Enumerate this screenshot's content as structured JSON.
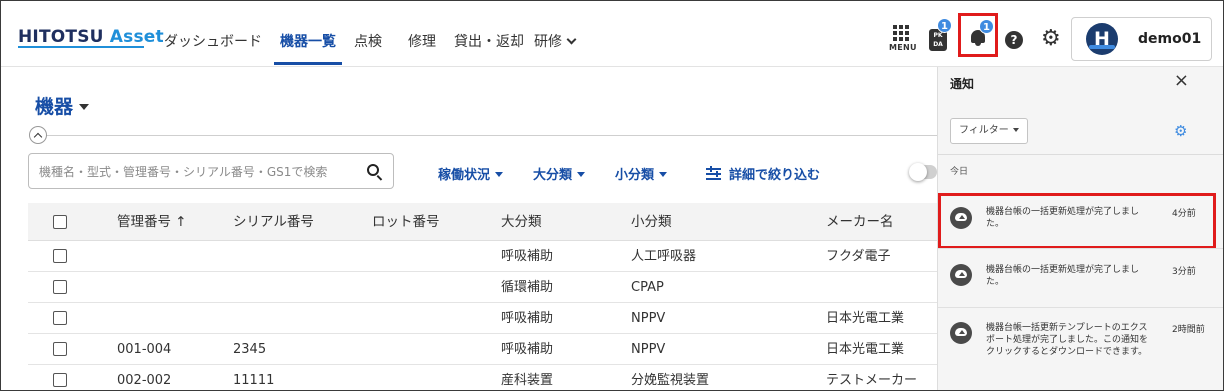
{
  "header": {
    "logo_part1": "HITOTSU",
    "logo_part2": "Asset",
    "nav": [
      {
        "label": "ダッシュボード"
      },
      {
        "label": "機器一覧"
      },
      {
        "label": "点検"
      },
      {
        "label": "修理"
      },
      {
        "label": "貸出・返却"
      },
      {
        "label": "研修"
      }
    ],
    "menu_label": "MENU",
    "qr_label": "PK DA",
    "qr_badge": "1",
    "bell_badge": "1",
    "help_glyph": "?",
    "avatar_initial": "H",
    "username": "demo01",
    "icons": [
      "menu-grid-icon",
      "qr-icon",
      "bell-icon",
      "help-icon",
      "gear-icon"
    ]
  },
  "main": {
    "title": "機器",
    "search": {
      "placeholder": "機種名・型式・管理番号・シリアル番号・GS1で検索"
    },
    "filters": [
      {
        "label": "稼働状況"
      },
      {
        "label": "大分類"
      },
      {
        "label": "小分類"
      }
    ],
    "advanced_filter": "詳細で絞り込む",
    "table": {
      "columns": [
        "管理番号 ↑",
        "シリアル番号",
        "ロット番号",
        "大分類",
        "小分類",
        "メーカー名"
      ],
      "rows": [
        {
          "id": "",
          "serial": "",
          "lot": "",
          "major": "呼吸補助",
          "minor": "人工呼吸器",
          "maker": "フクダ電子"
        },
        {
          "id": "",
          "serial": "",
          "lot": "",
          "major": "循環補助",
          "minor": "CPAP",
          "maker": ""
        },
        {
          "id": "",
          "serial": "",
          "lot": "",
          "major": "呼吸補助",
          "minor": "NPPV",
          "maker": "日本光電工業"
        },
        {
          "id": "001-004",
          "serial": "2345",
          "lot": "",
          "major": "呼吸補助",
          "minor": "NPPV",
          "maker": "日本光電工業"
        },
        {
          "id": "002-002",
          "serial": "11111",
          "lot": "",
          "major": "産科装置",
          "minor": "分娩監視装置",
          "maker": "テストメーカー"
        }
      ]
    }
  },
  "notifications": {
    "title": "通知",
    "close_glyph": "×",
    "filter_label": "フィルター",
    "section": "今日",
    "items": [
      {
        "text": "機器台帳の一括更新処理が完了しました。",
        "time": "4分前"
      },
      {
        "text": "機器台帳の一括更新処理が完了しました。",
        "time": "3分前"
      },
      {
        "text": "機器台帳一括更新テンプレートのエクスポート処理が完了しました。この通知をクリックするとダウンロードできます。",
        "time": "2時間前"
      }
    ]
  },
  "colors": {
    "accent": "#174ea6",
    "brand_light": "#1f8fd9",
    "badge": "#3f8be0",
    "highlight": "#e01b1b"
  }
}
